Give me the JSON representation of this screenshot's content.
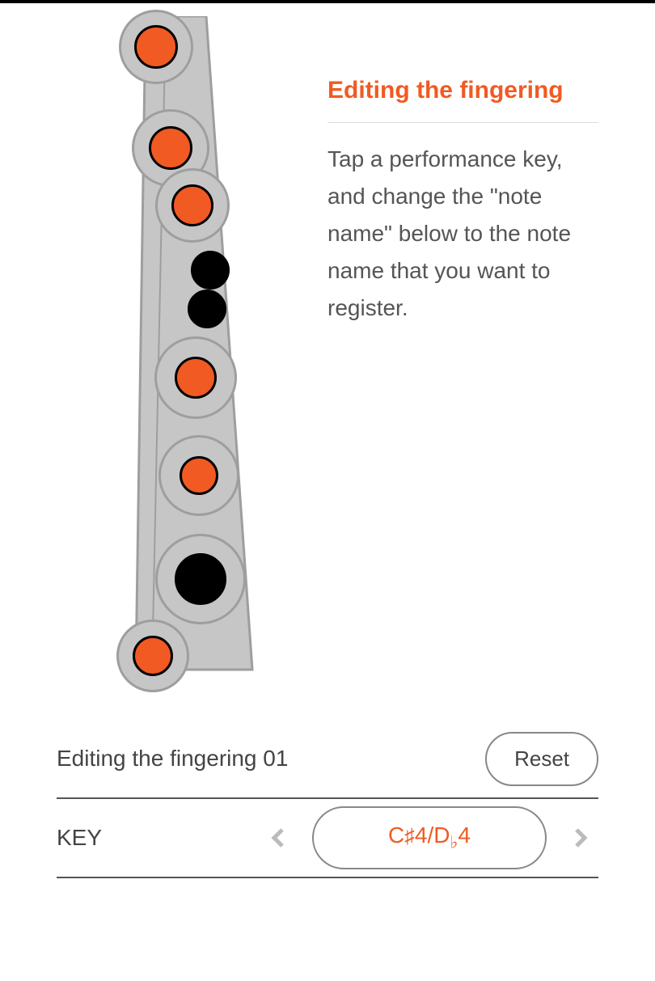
{
  "panel": {
    "title": "Editing the fingering",
    "body": "Tap a performance key, and change the \"note name\" below to the note name that you want to register."
  },
  "status": {
    "label": "Editing the fingering 01",
    "reset_label": "Reset"
  },
  "key": {
    "label": "KEY",
    "note_display": "C♯4/D♭4"
  },
  "colors": {
    "accent": "#f15a22",
    "body": "#c6c6c6",
    "outline": "#9e9e9e"
  },
  "fingering": {
    "holes": [
      {
        "id": "hole-1-thumb",
        "state": "orange",
        "ring": true
      },
      {
        "id": "hole-2",
        "state": "orange",
        "ring": true
      },
      {
        "id": "hole-3",
        "state": "orange",
        "ring": true
      },
      {
        "id": "hole-4-small",
        "state": "black",
        "ring": false
      },
      {
        "id": "hole-5-small",
        "state": "black",
        "ring": false
      },
      {
        "id": "hole-6",
        "state": "orange",
        "ring": true
      },
      {
        "id": "hole-7",
        "state": "orange",
        "ring": true
      },
      {
        "id": "hole-8",
        "state": "black",
        "ring": true
      },
      {
        "id": "hole-9-foot",
        "state": "orange",
        "ring": true
      }
    ]
  }
}
